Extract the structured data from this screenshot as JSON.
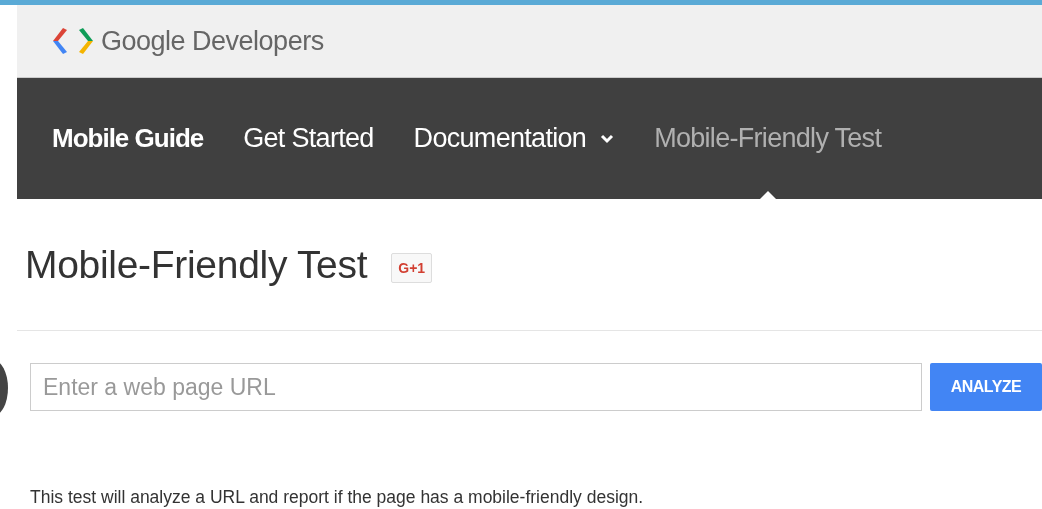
{
  "header": {
    "logo_text": "Google Developers"
  },
  "nav": {
    "items": [
      {
        "label": "Mobile Guide",
        "kind": "brand",
        "selected": false
      },
      {
        "label": "Get Started",
        "kind": "link",
        "selected": false
      },
      {
        "label": "Documentation",
        "kind": "dropdown",
        "selected": false
      },
      {
        "label": "Mobile-Friendly Test",
        "kind": "link",
        "selected": true
      }
    ]
  },
  "page": {
    "title": "Mobile-Friendly Test",
    "plus_button": "G+1",
    "url_field": {
      "placeholder": "Enter a web page URL"
    },
    "analyze_button": "ANALYZE",
    "description": "This test will analyze a URL and report if the page has a mobile-friendly design."
  }
}
